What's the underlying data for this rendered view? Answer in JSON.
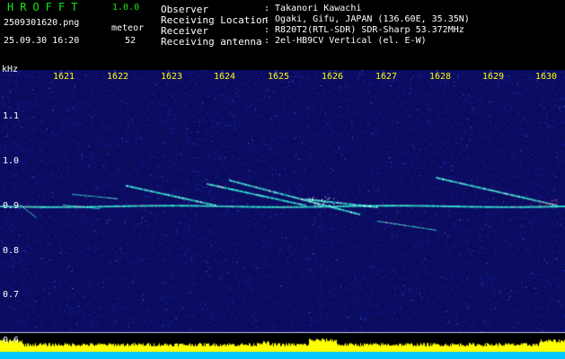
{
  "header": {
    "app_name": "HROFFT",
    "app_version": "1.0.0",
    "file_name": "2509301620.png",
    "datetime": "25.09.30 16:20",
    "mode_label": "meteor",
    "mode_count": "52",
    "info": [
      {
        "key": "Observer",
        "value": ": Takanori Kawachi"
      },
      {
        "key": "Receiving Location",
        "value": ": Ogaki, Gifu, JAPAN (136.60E, 35.35N)"
      },
      {
        "key": "Receiver",
        "value": ": R820T2(RTL-SDR) SDR-Sharp 53.372MHz"
      },
      {
        "key": "Receiving antenna",
        "value": ": 2el-HB9CV Vertical (el. E-W)"
      }
    ]
  },
  "spectrogram": {
    "unit": "kHz",
    "time_ticks": [
      "1621",
      "1622",
      "1623",
      "1624",
      "1625",
      "1626",
      "1627",
      "1628",
      "1629",
      "1630"
    ],
    "freq_ticks": [
      "1.1",
      "1.0",
      "0.9",
      "0.8",
      "0.7",
      "0.6"
    ],
    "colors": {
      "background": "#0b0b60",
      "noise": "#2233cc",
      "trace": "#33ffdd",
      "hot": "#ff4466",
      "level": "#ffff00",
      "floor": "#00c8ff"
    }
  }
}
